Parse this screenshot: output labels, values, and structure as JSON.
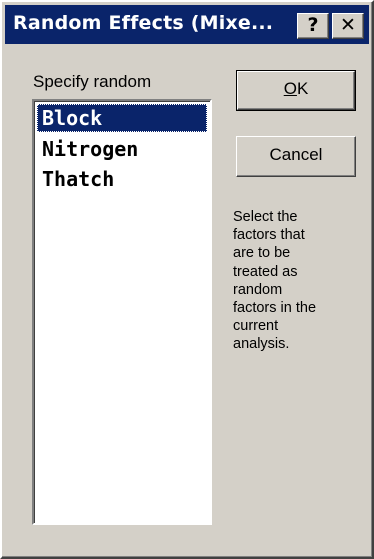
{
  "window": {
    "title": "Random Effects (Mixe...",
    "help_button": "?",
    "close_button": "✕"
  },
  "list": {
    "label": "Specify random",
    "items": [
      {
        "label": "Block",
        "selected": true
      },
      {
        "label": "Nitrogen",
        "selected": false
      },
      {
        "label": "Thatch",
        "selected": false
      }
    ]
  },
  "buttons": {
    "ok_underlined": "O",
    "ok_rest": "K",
    "cancel": "Cancel"
  },
  "help": {
    "lines": [
      "Select the",
      "factors that",
      "are to be",
      "treated as",
      "random",
      "factors in the",
      "current",
      "analysis."
    ]
  },
  "colors": {
    "titlebar": "#0a246a",
    "dialog_face": "#d4d0c8",
    "selection": "#0a246a"
  }
}
